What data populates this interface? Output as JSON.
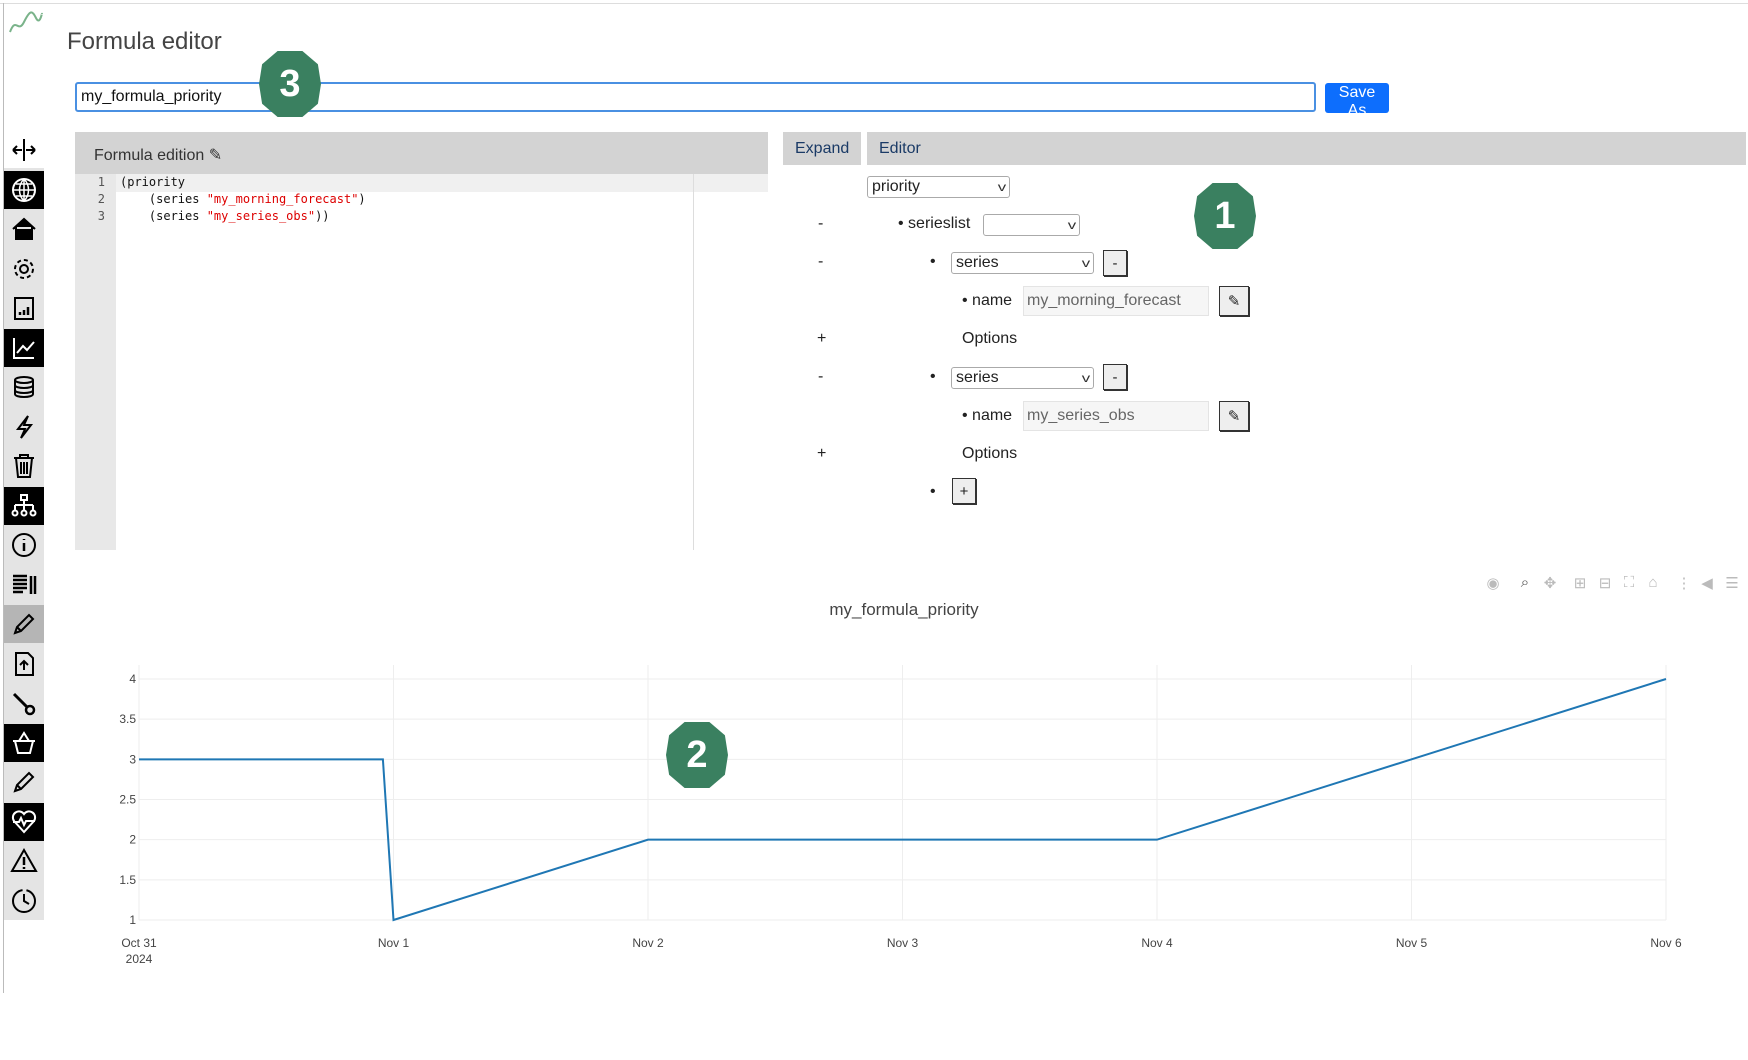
{
  "page": {
    "title": "Formula editor"
  },
  "formula_name": {
    "value": "my_formula_priority",
    "save_as_label": "Save As"
  },
  "sidebar": {
    "icons": [
      "resize-arrows-icon",
      "globe-icon",
      "home-icon",
      "gear-icon",
      "report-icon",
      "chart-icon",
      "database-icon",
      "lightning-icon",
      "trash-icon",
      "sitemap-icon",
      "info-icon",
      "list-icon",
      "pencil-icon",
      "upload-file-icon",
      "wrench-icon",
      "basket-icon",
      "pencil-icon",
      "heartbeat-icon",
      "warning-icon",
      "clock-icon"
    ],
    "selected": "pencil-icon"
  },
  "formula_panel": {
    "header": "Formula edition ✎",
    "lines": [
      {
        "num": "1",
        "code": "(priority"
      },
      {
        "num": "2",
        "code": "    (series ",
        "str": "\"my_morning_forecast\"",
        "tail": ")"
      },
      {
        "num": "3",
        "code": "    (series ",
        "str": "\"my_series_obs\"",
        "tail": "))"
      }
    ]
  },
  "editor": {
    "tabs": [
      "Expand",
      "Editor"
    ],
    "operator": "priority",
    "serieslist_label": "• serieslist",
    "serieslist_value": "",
    "series": [
      {
        "type": "series",
        "name_label": "• name",
        "name": "my_morning_forecast",
        "options_label": "Options"
      },
      {
        "type": "series",
        "name_label": "• name",
        "name": "my_series_obs",
        "options_label": "Options"
      }
    ],
    "minus": "-",
    "plus": "+",
    "bullet": "•",
    "edit_icon": "✎"
  },
  "badges": [
    "1",
    "2",
    "3"
  ],
  "chart_toolbar": [
    "camera-icon",
    "zoom-icon",
    "pan-icon",
    "zoom-in-icon",
    "zoom-out-icon",
    "autoscale-icon",
    "reset-axes-icon",
    "spike-lines-icon",
    "hover-closest-icon",
    "hover-compare-icon"
  ],
  "chart_data": {
    "type": "line",
    "title": "my_formula_priority",
    "x": [
      "2024-10-31 00:00",
      "2024-10-31 23:00",
      "2024-11-01 00:00",
      "2024-11-02 00:00",
      "2024-11-04 00:00",
      "2024-11-06 00:00"
    ],
    "y": [
      3,
      3,
      1,
      2,
      2,
      4
    ],
    "xticks": [
      [
        "Oct 31",
        "2024"
      ],
      [
        "Nov 1"
      ],
      [
        "Nov 2"
      ],
      [
        "Nov 3"
      ],
      [
        "Nov 4"
      ],
      [
        "Nov 5"
      ],
      [
        "Nov 6"
      ]
    ],
    "yticks": [
      "1",
      "1.5",
      "2",
      "2.5",
      "3",
      "3.5",
      "4"
    ],
    "ylim": [
      1,
      4
    ],
    "xlim": [
      "2024-10-31",
      "2024-11-06"
    ],
    "grid": true,
    "line_color": "#1f77b4"
  }
}
